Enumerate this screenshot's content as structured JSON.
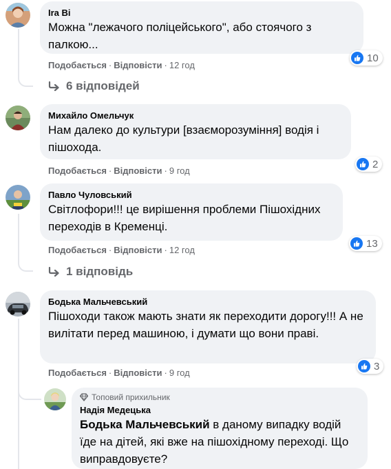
{
  "ui": {
    "like_label": "Подобається",
    "reply_label": "Відповісти",
    "separator": "·"
  },
  "comments": [
    {
      "author": "Іra Bi",
      "text": "Можна \"лежачого поліцейського\", або стоячого з палкою...",
      "time": "12 год",
      "reactions": "10",
      "replies_label": "6 відповідей"
    },
    {
      "author": "Михайло Омельчук",
      "text": "Нам далеко до культури [взаєморозуміння] водія і пішохода.",
      "time": "9 год",
      "reactions": "2"
    },
    {
      "author": "Павло Чуловський",
      "text": "Світлофори!!! це вирішення проблеми Пішохідних переходів в Кременці.",
      "time": "12 год",
      "reactions": "13",
      "replies_label": "1 відповідь"
    },
    {
      "author": "Бодька Мальчевський",
      "text": "Пішоходи також мають знати як переходити дорогу!!! А не вилітати перед машиною, і думати що вони праві.",
      "time": "9 год",
      "reactions": "3"
    }
  ],
  "reply": {
    "badge": "Топовий прихильник",
    "author": "Надія Медецька",
    "mention": "Бодька Мальчевський",
    "text": " в даному випадку водій їде на дітей, які вже на пішохідному переході. Що виправдовуєте?"
  },
  "colors": {
    "bubble": "#f0f2f5",
    "like_blue": "#1877f2",
    "secondary_text": "#65676b",
    "thread_line": "#e4e6eb"
  },
  "icons": [
    "like-icon",
    "reply-arrow-icon",
    "diamond-icon"
  ]
}
